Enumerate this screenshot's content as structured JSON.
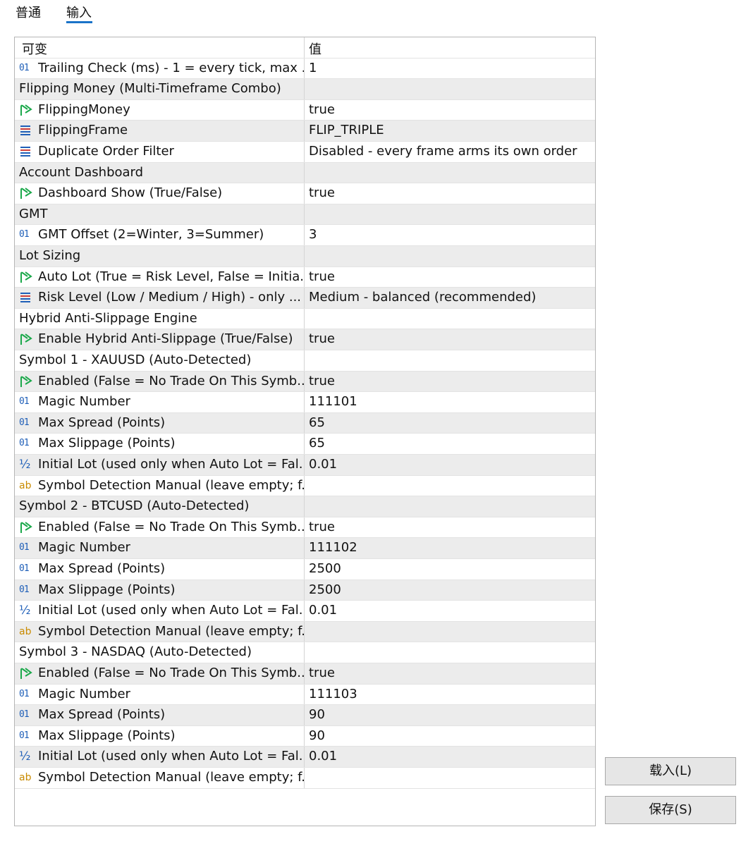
{
  "tabs": {
    "common": "普通",
    "inputs": "输入"
  },
  "columns": {
    "variable": "可变",
    "value": "值"
  },
  "rows": [
    {
      "type": "int",
      "name": "Trailing Check (ms) - 1 = every tick, max ...",
      "value": "1"
    },
    {
      "type": "group",
      "name": "Flipping Money (Multi-Timeframe Combo)",
      "value": ""
    },
    {
      "type": "bool",
      "name": "FlippingMoney",
      "value": "true"
    },
    {
      "type": "enum",
      "name": "FlippingFrame",
      "value": "FLIP_TRIPLE"
    },
    {
      "type": "enum",
      "name": "Duplicate Order Filter",
      "value": "Disabled - every frame arms its own order"
    },
    {
      "type": "group",
      "name": "Account Dashboard",
      "value": ""
    },
    {
      "type": "bool",
      "name": "Dashboard Show (True/False)",
      "value": "true"
    },
    {
      "type": "group",
      "name": "GMT",
      "value": ""
    },
    {
      "type": "int",
      "name": "GMT Offset (2=Winter, 3=Summer)",
      "value": "3"
    },
    {
      "type": "group",
      "name": "Lot Sizing",
      "value": ""
    },
    {
      "type": "bool",
      "name": "Auto Lot (True = Risk Level, False = Initia...",
      "value": "true"
    },
    {
      "type": "enum",
      "name": "Risk Level (Low / Medium / High) - only ...",
      "value": "Medium - balanced (recommended)"
    },
    {
      "type": "group",
      "name": "Hybrid Anti-Slippage Engine",
      "value": ""
    },
    {
      "type": "bool",
      "name": "Enable Hybrid Anti-Slippage (True/False)",
      "value": "true"
    },
    {
      "type": "group",
      "name": "Symbol 1 - XAUUSD (Auto-Detected)",
      "value": ""
    },
    {
      "type": "bool",
      "name": "Enabled (False = No Trade On This Symb...",
      "value": "true"
    },
    {
      "type": "int",
      "name": "Magic Number",
      "value": "111101"
    },
    {
      "type": "int",
      "name": "Max Spread (Points)",
      "value": "65"
    },
    {
      "type": "int",
      "name": "Max Slippage (Points)",
      "value": "65"
    },
    {
      "type": "double",
      "name": "Initial Lot (used only when Auto Lot = Fal...",
      "value": "0.01"
    },
    {
      "type": "string",
      "name": "Symbol Detection Manual (leave empty; f...",
      "value": ""
    },
    {
      "type": "group",
      "name": "Symbol 2 - BTCUSD (Auto-Detected)",
      "value": ""
    },
    {
      "type": "bool",
      "name": "Enabled (False = No Trade On This Symb...",
      "value": "true"
    },
    {
      "type": "int",
      "name": "Magic Number",
      "value": "111102"
    },
    {
      "type": "int",
      "name": "Max Spread (Points)",
      "value": "2500"
    },
    {
      "type": "int",
      "name": "Max Slippage (Points)",
      "value": "2500"
    },
    {
      "type": "double",
      "name": "Initial Lot (used only when Auto Lot = Fal...",
      "value": "0.01"
    },
    {
      "type": "string",
      "name": "Symbol Detection Manual (leave empty; f...",
      "value": ""
    },
    {
      "type": "group",
      "name": "Symbol 3 - NASDAQ (Auto-Detected)",
      "value": ""
    },
    {
      "type": "bool",
      "name": "Enabled (False = No Trade On This Symb...",
      "value": "true"
    },
    {
      "type": "int",
      "name": "Magic Number",
      "value": "111103"
    },
    {
      "type": "int",
      "name": "Max Spread (Points)",
      "value": "90"
    },
    {
      "type": "int",
      "name": "Max Slippage (Points)",
      "value": "90"
    },
    {
      "type": "double",
      "name": "Initial Lot (used only when Auto Lot = Fal...",
      "value": "0.01"
    },
    {
      "type": "string",
      "name": "Symbol Detection Manual (leave empty; f...",
      "value": ""
    }
  ],
  "icons": {
    "int": {
      "glyph": "01",
      "name": "integer-icon"
    },
    "double": {
      "glyph": "½",
      "name": "fraction-icon"
    },
    "string": {
      "glyph": "ab",
      "name": "text-icon"
    },
    "bool": {
      "glyph": "",
      "name": "bool-arrow-icon"
    },
    "enum": {
      "glyph": "",
      "name": "list-icon"
    }
  },
  "buttons": {
    "load": "载入(L)",
    "save": "保存(S)"
  },
  "colors": {
    "accent": "#1a73c8",
    "bool_icon": "#1aa84a",
    "int_icon": "#1f5fb8",
    "string_icon": "#c98b00",
    "enum_icon": "#d0403a"
  }
}
